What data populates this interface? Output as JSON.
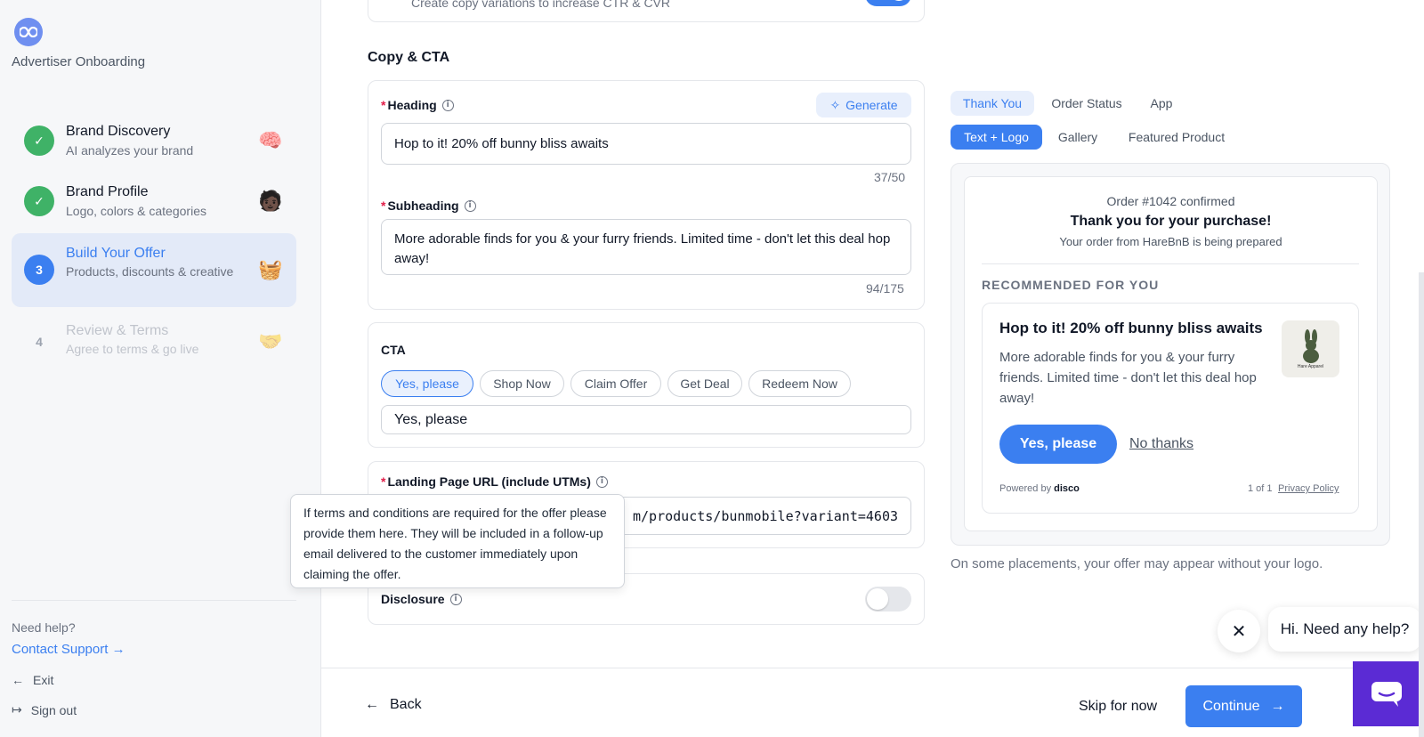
{
  "sidebar": {
    "app_title": "Advertiser Onboarding",
    "steps": [
      {
        "marker": "✓",
        "title": "Brand Discovery",
        "subtitle": "AI analyzes your brand",
        "emoji": "🧠",
        "status": "done"
      },
      {
        "marker": "✓",
        "title": "Brand Profile",
        "subtitle": "Logo, colors & categories",
        "emoji": "🧑🏿",
        "status": "done"
      },
      {
        "marker": "3",
        "title": "Build Your Offer",
        "subtitle": "Products, discounts & creative",
        "emoji": "🧺",
        "status": "active"
      },
      {
        "marker": "4",
        "title": "Review & Terms",
        "subtitle": "Agree to terms & go live",
        "emoji": "🤝",
        "status": "pending"
      }
    ],
    "need_help": "Need help?",
    "contact": "Contact Support →",
    "exit": "Exit",
    "sign_out": "Sign out"
  },
  "top_card": {
    "description": "Create copy variations to increase CTR & CVR"
  },
  "copy": {
    "section_title": "Copy & CTA",
    "heading_label": "Heading",
    "generate_label": "Generate",
    "heading_value": "Hop to it! 20% off bunny bliss awaits",
    "heading_count": "37/50",
    "subheading_label": "Subheading",
    "subheading_value": "More adorable finds for you & your furry friends. Limited time - don't let this deal hop away!",
    "subheading_count": "94/175"
  },
  "cta": {
    "label": "CTA",
    "options": [
      "Yes, please",
      "Shop Now",
      "Claim Offer",
      "Get Deal",
      "Redeem Now"
    ],
    "selected": "Yes, please",
    "value": "Yes, please"
  },
  "landing": {
    "label": "Landing Page URL (include UTMs)",
    "value": "m/products/bunmobile?variant=4603"
  },
  "tooltip": "If terms and conditions are required for the offer please provide them here. They will be included in a follow-up email delivered to the customer immediately upon claiming the offer.",
  "disclosure": {
    "label": "Disclosure",
    "on": false
  },
  "footer": {
    "back": "Back",
    "skip": "Skip for now",
    "continue": "Continue"
  },
  "preview": {
    "placement_tabs": [
      "Thank You",
      "Order Status",
      "App"
    ],
    "layout_tabs": [
      "Text + Logo",
      "Gallery",
      "Featured Product"
    ],
    "order": "Order #1042 confirmed",
    "thanks": "Thank you for your purchase!",
    "order_sub": "Your order from HareBnB is being prepared",
    "recommended": "RECOMMENDED FOR YOU",
    "offer_title": "Hop to it! 20% off bunny bliss awaits",
    "offer_body": "More adorable finds for you & your furry friends. Limited time - don't let this deal hop away!",
    "yes_button": "Yes, please",
    "no_thanks": "No thanks",
    "powered_by": "Powered by",
    "powered_brand": "disco",
    "pager": "1 of 1",
    "privacy": "Privacy Policy",
    "thumb_caption": "Hare Apparel",
    "note": "On some placements, your offer may appear without your logo."
  },
  "chat": {
    "bubble": "Hi. Need any help?"
  },
  "colors": {
    "accent": "#3b7ff0",
    "success": "#3fb267",
    "chat": "#5b2bd4"
  }
}
